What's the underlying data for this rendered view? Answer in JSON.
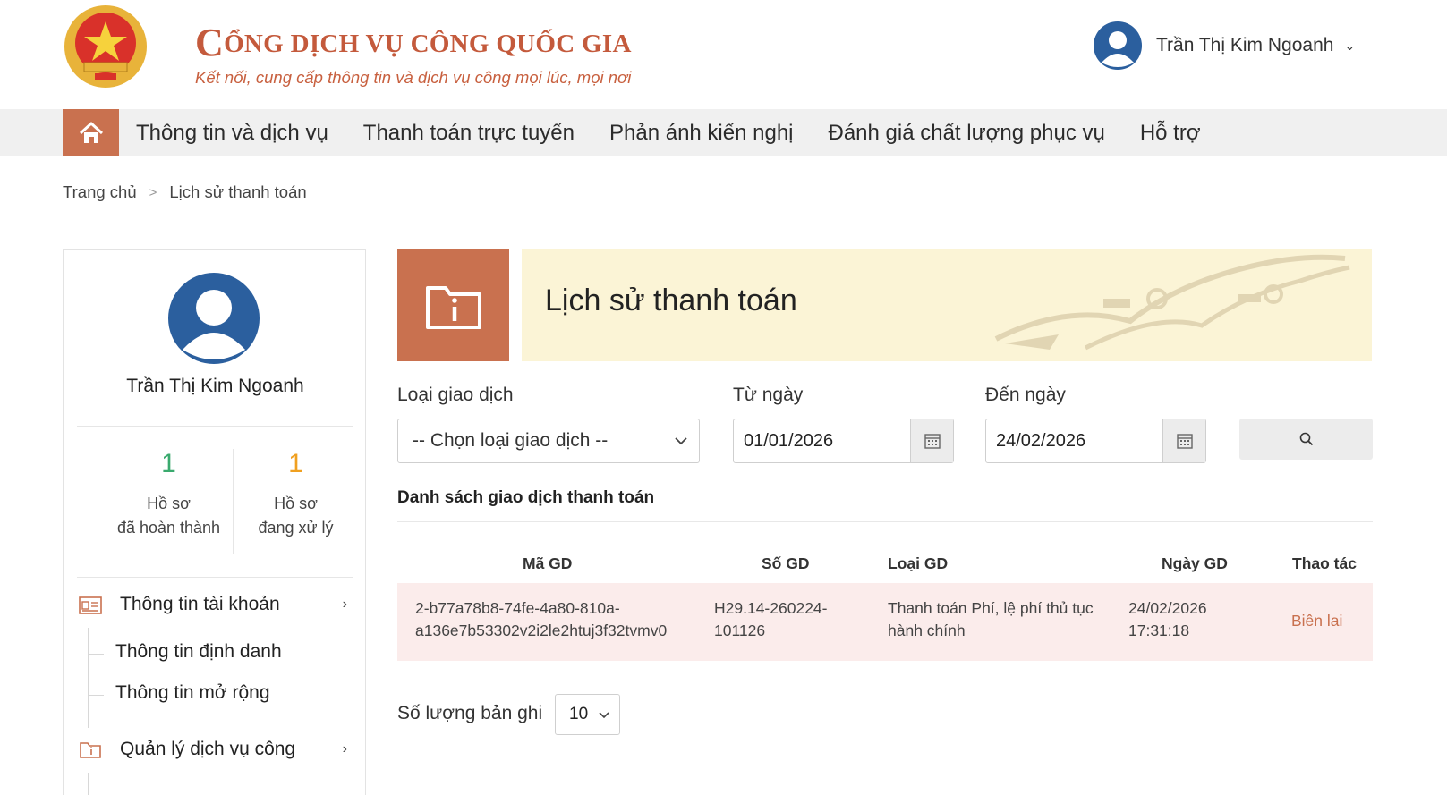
{
  "header": {
    "brand_title_initial": "C",
    "brand_title_rest": "ỔNG DỊCH VỤ CÔNG QUỐC GIA",
    "tagline": "Kết nối, cung cấp thông tin và dịch vụ công mọi lúc, mọi nơi",
    "user_name": "Trần Thị Kim Ngoanh"
  },
  "nav": {
    "items": [
      "Thông tin và dịch vụ",
      "Thanh toán trực tuyến",
      "Phản ánh kiến nghị",
      "Đánh giá chất lượng phục vụ",
      "Hỗ trợ"
    ]
  },
  "breadcrumb": {
    "home": "Trang chủ",
    "separator": ">",
    "current": "Lịch sử thanh toán"
  },
  "sidebar": {
    "user_name": "Trần Thị Kim Ngoanh",
    "stats": [
      {
        "value": "1",
        "line1": "Hồ sơ",
        "line2": "đã hoàn thành",
        "color": "#3aaa6e"
      },
      {
        "value": "1",
        "line1": "Hồ sơ",
        "line2": "đang xử lý",
        "color": "#f0a020"
      }
    ],
    "menu": [
      {
        "label": "Thông tin tài khoản",
        "sub": [
          "Thông tin định danh",
          "Thông tin mở rộng"
        ]
      },
      {
        "label": "Quản lý dịch vụ công"
      }
    ]
  },
  "page": {
    "title": "Lịch sử thanh toán"
  },
  "filters": {
    "type_label": "Loại giao dịch",
    "type_value": "-- Chọn loại giao dịch --",
    "from_label": "Từ ngày",
    "from_value": "01/01/2026",
    "to_label": "Đến ngày",
    "to_value": "24/02/2026"
  },
  "list": {
    "title": "Danh sách giao dịch thanh toán",
    "columns": [
      "Mã GD",
      "Số GD",
      "Loại GD",
      "Ngày GD",
      "Thao tác"
    ],
    "rows": [
      {
        "ma_gd_1": "2-b77a78b8-74fe-4a80-810a-",
        "ma_gd_2": "a136e7b53302v2i2le2htuj3f32tvmv0",
        "so_gd_1": "H29.14-260224-",
        "so_gd_2": "101126",
        "loai_gd_1": "Thanh toán Phí, lệ phí thủ tục",
        "loai_gd_2": "hành chính",
        "ngay_gd_1": "24/02/2026",
        "ngay_gd_2": "17:31:18",
        "action": "Biên lai"
      }
    ]
  },
  "pagination": {
    "label": "Số lượng bản ghi",
    "value": "10"
  },
  "colors": {
    "accent": "#c9714f",
    "banner_bg": "#fbf4d6",
    "row_bg": "#fbeceb",
    "avatar_blue": "#2b5f9e"
  }
}
